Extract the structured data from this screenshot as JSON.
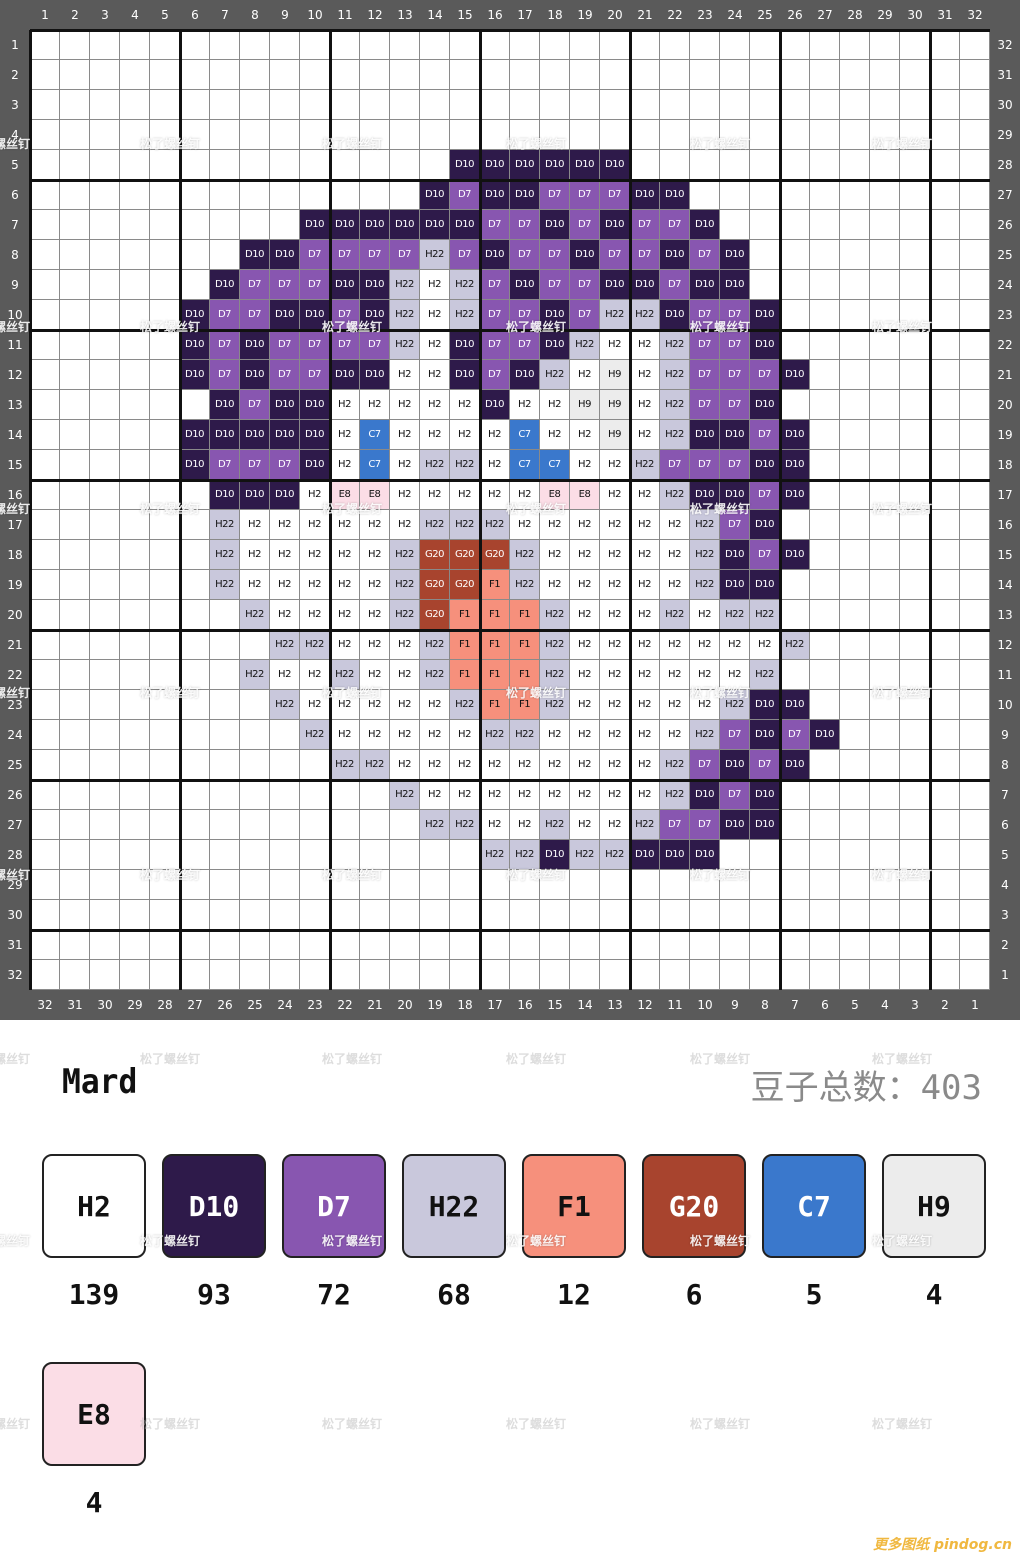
{
  "brand": "Mard",
  "total_label": "豆子总数：403",
  "watermark": "松了螺丝钉",
  "site": "更多图纸 pindog.cn",
  "palette": {
    "H2": {
      "hex": "#ffffff",
      "text": "#111111"
    },
    "D10": {
      "hex": "#2e1a4a",
      "text": "#ffffff"
    },
    "D7": {
      "hex": "#8856b0",
      "text": "#ffffff"
    },
    "H22": {
      "hex": "#c9c8dc",
      "text": "#111111"
    },
    "F1": {
      "hex": "#f6907c",
      "text": "#111111"
    },
    "G20": {
      "hex": "#a8442e",
      "text": "#ffffff"
    },
    "C7": {
      "hex": "#3a78cc",
      "text": "#ffffff"
    },
    "H9": {
      "hex": "#ececec",
      "text": "#111111"
    },
    "E8": {
      "hex": "#fbdde6",
      "text": "#111111"
    }
  },
  "legend": [
    {
      "code": "H2",
      "count": "139"
    },
    {
      "code": "D10",
      "count": "93"
    },
    {
      "code": "D7",
      "count": "72"
    },
    {
      "code": "H22",
      "count": "68"
    },
    {
      "code": "F1",
      "count": "12"
    },
    {
      "code": "G20",
      "count": "6"
    },
    {
      "code": "C7",
      "count": "5"
    },
    {
      "code": "H9",
      "count": "4"
    },
    {
      "code": "E8",
      "count": "4"
    }
  ],
  "grid": {
    "size": 32,
    "rows": {
      "5": {
        "15": "D10",
        "16": "D10",
        "17": "D10",
        "18": "D10",
        "19": "D10",
        "20": "D10"
      },
      "6": {
        "14": "D10",
        "15": "D7",
        "16": "D10",
        "17": "D10",
        "18": "D7",
        "19": "D7",
        "20": "D7",
        "21": "D10",
        "22": "D10"
      },
      "7": {
        "10": "D10",
        "11": "D10",
        "12": "D10",
        "13": "D10",
        "14": "D10",
        "15": "D10",
        "16": "D7",
        "17": "D7",
        "18": "D10",
        "19": "D7",
        "20": "D10",
        "21": "D7",
        "22": "D7",
        "23": "D10"
      },
      "8": {
        "8": "D10",
        "9": "D10",
        "10": "D7",
        "11": "D7",
        "12": "D7",
        "13": "D7",
        "14": "H22",
        "15": "D7",
        "16": "D10",
        "17": "D7",
        "18": "D7",
        "19": "D10",
        "20": "D7",
        "21": "D7",
        "22": "D10",
        "23": "D7",
        "24": "D10"
      },
      "9": {
        "7": "D10",
        "8": "D7",
        "9": "D7",
        "10": "D7",
        "11": "D10",
        "12": "D10",
        "13": "H22",
        "14": "H2",
        "15": "H22",
        "16": "D7",
        "17": "D10",
        "18": "D7",
        "19": "D7",
        "20": "D10",
        "21": "D10",
        "22": "D7",
        "23": "D10",
        "24": "D10"
      },
      "10": {
        "6": "D10",
        "7": "D7",
        "8": "D7",
        "9": "D10",
        "10": "D10",
        "11": "D7",
        "12": "D10",
        "13": "H22",
        "14": "H2",
        "15": "H22",
        "16": "D7",
        "17": "D7",
        "18": "D10",
        "19": "D7",
        "20": "H22",
        "21": "H22",
        "22": "D10",
        "23": "D7",
        "24": "D7",
        "25": "D10"
      },
      "11": {
        "6": "D10",
        "7": "D7",
        "8": "D10",
        "9": "D7",
        "10": "D7",
        "11": "D7",
        "12": "D7",
        "13": "H22",
        "14": "H2",
        "15": "D10",
        "16": "D7",
        "17": "D7",
        "18": "D10",
        "19": "H22",
        "20": "H2",
        "21": "H2",
        "22": "H22",
        "23": "D7",
        "24": "D7",
        "25": "D10"
      },
      "12": {
        "6": "D10",
        "7": "D7",
        "8": "D10",
        "9": "D7",
        "10": "D7",
        "11": "D10",
        "12": "D10",
        "13": "H2",
        "14": "H2",
        "15": "D10",
        "16": "D7",
        "17": "D10",
        "18": "H22",
        "19": "H2",
        "20": "H9",
        "21": "H2",
        "22": "H22",
        "23": "D7",
        "24": "D7",
        "25": "D7",
        "26": "D10"
      },
      "13": {
        "7": "D10",
        "8": "D7",
        "9": "D10",
        "10": "D10",
        "11": "H2",
        "12": "H2",
        "13": "H2",
        "14": "H2",
        "15": "H2",
        "16": "D10",
        "17": "H2",
        "18": "H2",
        "19": "H9",
        "20": "H9",
        "21": "H2",
        "22": "H22",
        "23": "D7",
        "24": "D7",
        "25": "D10"
      },
      "14": {
        "6": "D10",
        "7": "D10",
        "8": "D10",
        "9": "D10",
        "10": "D10",
        "11": "H2",
        "12": "C7",
        "13": "H2",
        "14": "H2",
        "15": "H2",
        "16": "H2",
        "17": "C7",
        "18": "H2",
        "19": "H2",
        "20": "H9",
        "21": "H2",
        "22": "H22",
        "23": "D10",
        "24": "D10",
        "25": "D7",
        "26": "D10"
      },
      "15": {
        "6": "D10",
        "7": "D7",
        "8": "D7",
        "9": "D7",
        "10": "D10",
        "11": "H2",
        "12": "C7",
        "13": "H2",
        "14": "H22",
        "15": "H22",
        "16": "H2",
        "17": "C7",
        "18": "C7",
        "19": "H2",
        "20": "H2",
        "21": "H22",
        "22": "D7",
        "23": "D7",
        "24": "D7",
        "25": "D10",
        "26": "D10"
      },
      "16": {
        "7": "D10",
        "8": "D10",
        "9": "D10",
        "10": "H2",
        "11": "E8",
        "12": "E8",
        "13": "H2",
        "14": "H2",
        "15": "H2",
        "16": "H2",
        "17": "H2",
        "18": "E8",
        "19": "E8",
        "20": "H2",
        "21": "H2",
        "22": "H22",
        "23": "D10",
        "24": "D10",
        "25": "D7",
        "26": "D10"
      },
      "17": {
        "7": "H22",
        "8": "H2",
        "9": "H2",
        "10": "H2",
        "11": "H2",
        "12": "H2",
        "13": "H2",
        "14": "H22",
        "15": "H22",
        "16": "H22",
        "17": "H2",
        "18": "H2",
        "19": "H2",
        "20": "H2",
        "21": "H2",
        "22": "H2",
        "23": "H22",
        "24": "D7",
        "25": "D10"
      },
      "18": {
        "7": "H22",
        "8": "H2",
        "9": "H2",
        "10": "H2",
        "11": "H2",
        "12": "H2",
        "13": "H22",
        "14": "G20",
        "15": "G20",
        "16": "G20",
        "17": "H22",
        "18": "H2",
        "19": "H2",
        "20": "H2",
        "21": "H2",
        "22": "H2",
        "23": "H22",
        "24": "D10",
        "25": "D7",
        "26": "D10"
      },
      "19": {
        "7": "H22",
        "8": "H2",
        "9": "H2",
        "10": "H2",
        "11": "H2",
        "12": "H2",
        "13": "H22",
        "14": "G20",
        "15": "G20",
        "16": "F1",
        "17": "H22",
        "18": "H2",
        "19": "H2",
        "20": "H2",
        "21": "H2",
        "22": "H2",
        "23": "H22",
        "24": "D10",
        "25": "D10"
      },
      "20": {
        "8": "H22",
        "9": "H2",
        "10": "H2",
        "11": "H2",
        "12": "H2",
        "13": "H22",
        "14": "G20",
        "15": "F1",
        "16": "F1",
        "17": "F1",
        "18": "H22",
        "19": "H2",
        "20": "H2",
        "21": "H2",
        "22": "H22",
        "23": "H2",
        "24": "H22",
        "25": "H22"
      },
      "21": {
        "9": "H22",
        "10": "H22",
        "11": "H2",
        "12": "H2",
        "13": "H2",
        "14": "H22",
        "15": "F1",
        "16": "F1",
        "17": "F1",
        "18": "H22",
        "19": "H2",
        "20": "H2",
        "21": "H2",
        "22": "H2",
        "23": "H2",
        "24": "H2",
        "25": "H2",
        "26": "H22"
      },
      "22": {
        "8": "H22",
        "9": "H2",
        "10": "H2",
        "11": "H22",
        "12": "H2",
        "13": "H2",
        "14": "H22",
        "15": "F1",
        "16": "F1",
        "17": "F1",
        "18": "H22",
        "19": "H2",
        "20": "H2",
        "21": "H2",
        "22": "H2",
        "23": "H2",
        "24": "H2",
        "25": "H22"
      },
      "23": {
        "9": "H22",
        "10": "H2",
        "11": "H2",
        "12": "H2",
        "13": "H2",
        "14": "H2",
        "15": "H22",
        "16": "F1",
        "17": "F1",
        "18": "H22",
        "19": "H2",
        "20": "H2",
        "21": "H2",
        "22": "H2",
        "23": "H2",
        "24": "H22",
        "25": "D10",
        "26": "D10"
      },
      "24": {
        "10": "H22",
        "11": "H2",
        "12": "H2",
        "13": "H2",
        "14": "H2",
        "15": "H2",
        "16": "H22",
        "17": "H22",
        "18": "H2",
        "19": "H2",
        "20": "H2",
        "21": "H2",
        "22": "H2",
        "23": "H22",
        "24": "D7",
        "25": "D10",
        "26": "D7",
        "27": "D10"
      },
      "25": {
        "11": "H22",
        "12": "H22",
        "13": "H2",
        "14": "H2",
        "15": "H2",
        "16": "H2",
        "17": "H2",
        "18": "H2",
        "19": "H2",
        "20": "H2",
        "21": "H2",
        "22": "H22",
        "23": "D7",
        "24": "D10",
        "25": "D7",
        "26": "D10"
      },
      "26": {
        "13": "H22",
        "14": "H2",
        "15": "H2",
        "16": "H2",
        "17": "H2",
        "18": "H2",
        "19": "H2",
        "20": "H2",
        "21": "H2",
        "22": "H22",
        "23": "D10",
        "24": "D7",
        "25": "D10"
      },
      "27": {
        "14": "H22",
        "15": "H22",
        "16": "H2",
        "17": "H2",
        "18": "H22",
        "19": "H2",
        "20": "H2",
        "21": "H22",
        "22": "D7",
        "23": "D7",
        "24": "D10",
        "25": "D10"
      },
      "28": {
        "16": "H22",
        "17": "H22",
        "18": "D10",
        "19": "H22",
        "20": "H22",
        "21": "D10",
        "22": "D10",
        "23": "D10"
      }
    }
  }
}
